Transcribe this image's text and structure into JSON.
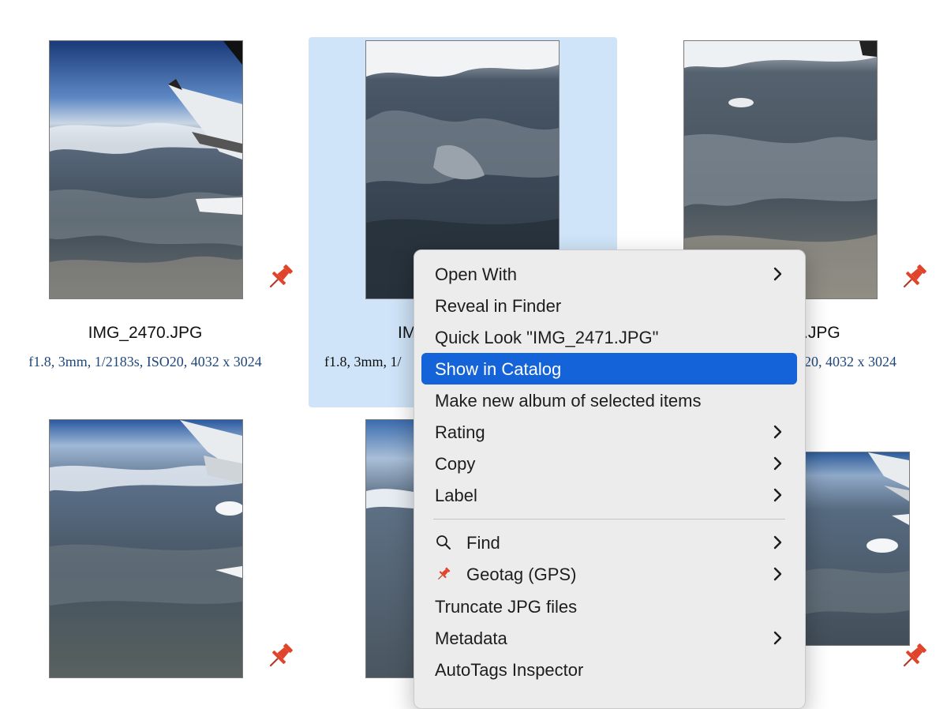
{
  "thumbnails": [
    {
      "file_name": "IMG_2470.JPG",
      "metadata": "f1.8, 3mm, 1/2183s, ISO20, 4032 x 3024",
      "pinned": true,
      "selected": false
    },
    {
      "file_name": "IM",
      "metadata": "f1.8, 3mm, 1/",
      "pinned": false,
      "selected": true
    },
    {
      "file_name": ".JPG",
      "metadata": "20, 4032 x 3024",
      "pinned": true,
      "selected": false
    }
  ],
  "context_menu": {
    "items": [
      {
        "label": "Open With",
        "submenu": true
      },
      {
        "label": "Reveal in Finder",
        "submenu": false
      },
      {
        "label": "Quick Look \"IMG_2471.JPG\"",
        "submenu": false
      },
      {
        "label": "Show in Catalog",
        "submenu": false,
        "highlighted": true
      },
      {
        "label": "Make new album of selected items",
        "submenu": false
      },
      {
        "label": "Rating",
        "submenu": true
      },
      {
        "label": "Copy",
        "submenu": true
      },
      {
        "label": "Label",
        "submenu": true
      },
      {
        "label": "Find",
        "submenu": true,
        "icon": "magnifier-icon"
      },
      {
        "label": "Geotag (GPS)",
        "submenu": true,
        "icon": "pushpin-icon"
      },
      {
        "label": "Truncate JPG files",
        "submenu": false
      },
      {
        "label": "Metadata",
        "submenu": true
      },
      {
        "label": "AutoTags Inspector",
        "submenu": false
      }
    ]
  },
  "colors": {
    "selection_bg": "#cfe4f8",
    "menu_highlight": "#1463d8",
    "metadata_text": "#20487a",
    "pin": "#e0452c"
  }
}
